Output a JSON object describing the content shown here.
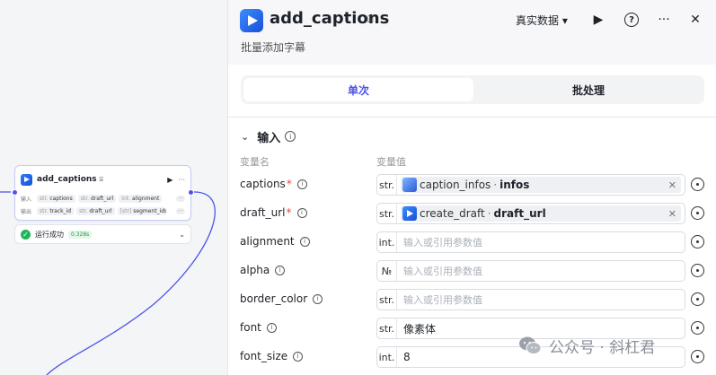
{
  "node": {
    "title": "add_captions",
    "input_label": "输入",
    "output_label": "输出",
    "inputs": [
      {
        "type": "str.",
        "name": "captions"
      },
      {
        "type": "str.",
        "name": "draft_url"
      },
      {
        "type": "int.",
        "name": "alignment"
      }
    ],
    "outputs": [
      {
        "type": "str.",
        "name": "track_id"
      },
      {
        "type": "str.",
        "name": "draft_url"
      },
      {
        "type": "[str]",
        "name": "segment_ids"
      }
    ],
    "status_text": "运行成功",
    "status_time": "0.328s"
  },
  "panel": {
    "title": "add_captions",
    "description": "批量添加字幕",
    "mode_select": "真实数据 ▾",
    "tabs": {
      "single": "单次",
      "batch": "批处理"
    },
    "section_title": "输入",
    "col_name": "变量名",
    "col_value": "变量值",
    "placeholder": "输入或引用参数值",
    "params": [
      {
        "name": "captions",
        "required": true,
        "type": "str.",
        "ref_node": "caption_infos",
        "ref_var": "infos"
      },
      {
        "name": "draft_url",
        "required": true,
        "type": "str.",
        "ref_node": "create_draft",
        "ref_var": "draft_url"
      },
      {
        "name": "alignment",
        "required": false,
        "type": "int."
      },
      {
        "name": "alpha",
        "required": false,
        "type": "№"
      },
      {
        "name": "border_color",
        "required": false,
        "type": "str."
      },
      {
        "name": "font",
        "required": false,
        "type": "str.",
        "value": "像素体"
      },
      {
        "name": "font_size",
        "required": false,
        "type": "int.",
        "value": "8"
      }
    ]
  },
  "watermark": "公众号 · 斜杠君",
  "colors": {
    "accent": "#4d53e8",
    "success": "#22b45a",
    "required": "#e54545"
  }
}
